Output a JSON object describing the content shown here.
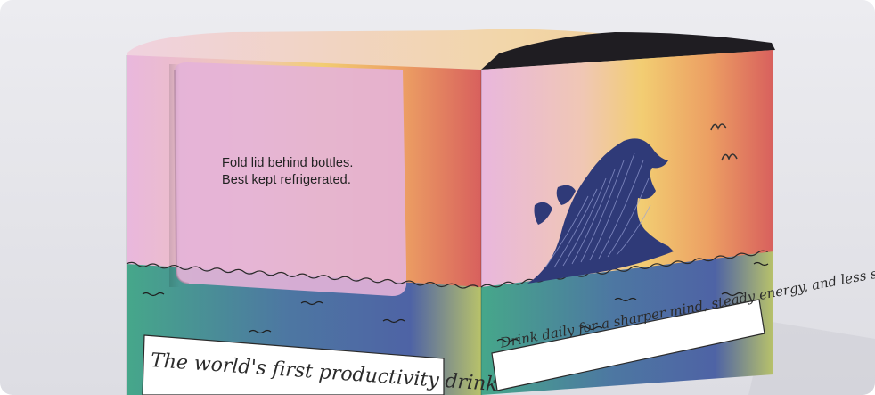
{
  "image": {
    "description_colors": {
      "background": "#e7e7ec",
      "pink": "#e8b6dc",
      "yellow": "#f2cc72",
      "orange": "#ea9a63",
      "red": "#d8605d",
      "wave_blue": "#2f3a78",
      "sea_blue": "#4d65a6",
      "sea_green": "#47a889"
    },
    "box_text": {
      "instruction_line1": "Fold lid behind bottles.",
      "instruction_line2": "Best kept refrigerated.",
      "tagline_left": "The world's first productivity drink",
      "tagline_right": "Drink daily for a sharper mind, steady energy, and less stress."
    },
    "icons": [
      "wave-illustration",
      "bird-icon",
      "bird-icon"
    ]
  }
}
